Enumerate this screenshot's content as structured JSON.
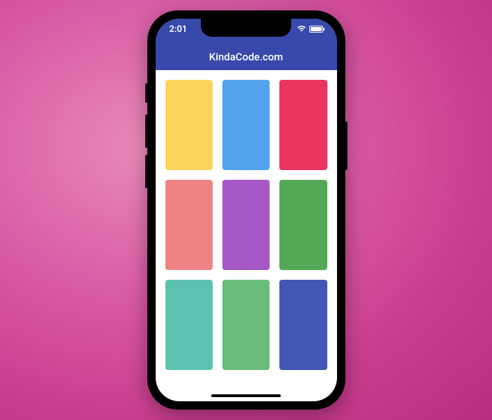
{
  "status": {
    "time": "2:01"
  },
  "appbar": {
    "title": "KindaCode.com",
    "bg_color": "#3949ab"
  },
  "grid": {
    "tiles": [
      {
        "color": "#fcd45b"
      },
      {
        "color": "#51a4ec"
      },
      {
        "color": "#e8345f"
      },
      {
        "color": "#ef8383"
      },
      {
        "color": "#a658c6"
      },
      {
        "color": "#54a857"
      },
      {
        "color": "#5bc2b0"
      },
      {
        "color": "#6bbc7a"
      },
      {
        "color": "#4356b3"
      }
    ]
  }
}
